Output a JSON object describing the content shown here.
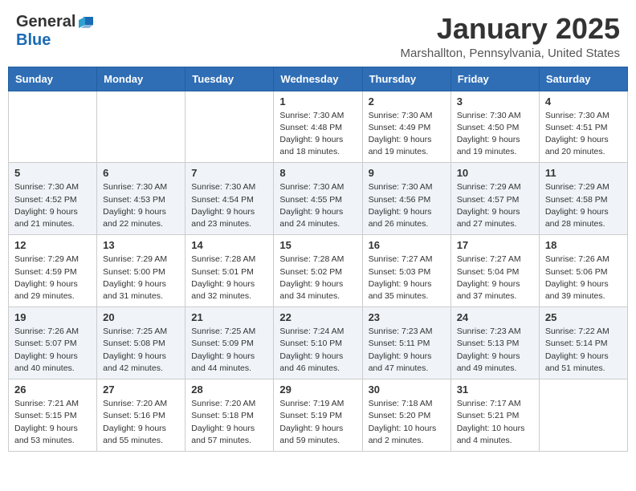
{
  "header": {
    "logo_general": "General",
    "logo_blue": "Blue",
    "month_title": "January 2025",
    "location": "Marshallton, Pennsylvania, United States"
  },
  "days_of_week": [
    "Sunday",
    "Monday",
    "Tuesday",
    "Wednesday",
    "Thursday",
    "Friday",
    "Saturday"
  ],
  "weeks": [
    {
      "days": [
        {
          "number": "",
          "info": ""
        },
        {
          "number": "",
          "info": ""
        },
        {
          "number": "",
          "info": ""
        },
        {
          "number": "1",
          "info": "Sunrise: 7:30 AM\nSunset: 4:48 PM\nDaylight: 9 hours\nand 18 minutes."
        },
        {
          "number": "2",
          "info": "Sunrise: 7:30 AM\nSunset: 4:49 PM\nDaylight: 9 hours\nand 19 minutes."
        },
        {
          "number": "3",
          "info": "Sunrise: 7:30 AM\nSunset: 4:50 PM\nDaylight: 9 hours\nand 19 minutes."
        },
        {
          "number": "4",
          "info": "Sunrise: 7:30 AM\nSunset: 4:51 PM\nDaylight: 9 hours\nand 20 minutes."
        }
      ]
    },
    {
      "days": [
        {
          "number": "5",
          "info": "Sunrise: 7:30 AM\nSunset: 4:52 PM\nDaylight: 9 hours\nand 21 minutes."
        },
        {
          "number": "6",
          "info": "Sunrise: 7:30 AM\nSunset: 4:53 PM\nDaylight: 9 hours\nand 22 minutes."
        },
        {
          "number": "7",
          "info": "Sunrise: 7:30 AM\nSunset: 4:54 PM\nDaylight: 9 hours\nand 23 minutes."
        },
        {
          "number": "8",
          "info": "Sunrise: 7:30 AM\nSunset: 4:55 PM\nDaylight: 9 hours\nand 24 minutes."
        },
        {
          "number": "9",
          "info": "Sunrise: 7:30 AM\nSunset: 4:56 PM\nDaylight: 9 hours\nand 26 minutes."
        },
        {
          "number": "10",
          "info": "Sunrise: 7:29 AM\nSunset: 4:57 PM\nDaylight: 9 hours\nand 27 minutes."
        },
        {
          "number": "11",
          "info": "Sunrise: 7:29 AM\nSunset: 4:58 PM\nDaylight: 9 hours\nand 28 minutes."
        }
      ]
    },
    {
      "days": [
        {
          "number": "12",
          "info": "Sunrise: 7:29 AM\nSunset: 4:59 PM\nDaylight: 9 hours\nand 29 minutes."
        },
        {
          "number": "13",
          "info": "Sunrise: 7:29 AM\nSunset: 5:00 PM\nDaylight: 9 hours\nand 31 minutes."
        },
        {
          "number": "14",
          "info": "Sunrise: 7:28 AM\nSunset: 5:01 PM\nDaylight: 9 hours\nand 32 minutes."
        },
        {
          "number": "15",
          "info": "Sunrise: 7:28 AM\nSunset: 5:02 PM\nDaylight: 9 hours\nand 34 minutes."
        },
        {
          "number": "16",
          "info": "Sunrise: 7:27 AM\nSunset: 5:03 PM\nDaylight: 9 hours\nand 35 minutes."
        },
        {
          "number": "17",
          "info": "Sunrise: 7:27 AM\nSunset: 5:04 PM\nDaylight: 9 hours\nand 37 minutes."
        },
        {
          "number": "18",
          "info": "Sunrise: 7:26 AM\nSunset: 5:06 PM\nDaylight: 9 hours\nand 39 minutes."
        }
      ]
    },
    {
      "days": [
        {
          "number": "19",
          "info": "Sunrise: 7:26 AM\nSunset: 5:07 PM\nDaylight: 9 hours\nand 40 minutes."
        },
        {
          "number": "20",
          "info": "Sunrise: 7:25 AM\nSunset: 5:08 PM\nDaylight: 9 hours\nand 42 minutes."
        },
        {
          "number": "21",
          "info": "Sunrise: 7:25 AM\nSunset: 5:09 PM\nDaylight: 9 hours\nand 44 minutes."
        },
        {
          "number": "22",
          "info": "Sunrise: 7:24 AM\nSunset: 5:10 PM\nDaylight: 9 hours\nand 46 minutes."
        },
        {
          "number": "23",
          "info": "Sunrise: 7:23 AM\nSunset: 5:11 PM\nDaylight: 9 hours\nand 47 minutes."
        },
        {
          "number": "24",
          "info": "Sunrise: 7:23 AM\nSunset: 5:13 PM\nDaylight: 9 hours\nand 49 minutes."
        },
        {
          "number": "25",
          "info": "Sunrise: 7:22 AM\nSunset: 5:14 PM\nDaylight: 9 hours\nand 51 minutes."
        }
      ]
    },
    {
      "days": [
        {
          "number": "26",
          "info": "Sunrise: 7:21 AM\nSunset: 5:15 PM\nDaylight: 9 hours\nand 53 minutes."
        },
        {
          "number": "27",
          "info": "Sunrise: 7:20 AM\nSunset: 5:16 PM\nDaylight: 9 hours\nand 55 minutes."
        },
        {
          "number": "28",
          "info": "Sunrise: 7:20 AM\nSunset: 5:18 PM\nDaylight: 9 hours\nand 57 minutes."
        },
        {
          "number": "29",
          "info": "Sunrise: 7:19 AM\nSunset: 5:19 PM\nDaylight: 9 hours\nand 59 minutes."
        },
        {
          "number": "30",
          "info": "Sunrise: 7:18 AM\nSunset: 5:20 PM\nDaylight: 10 hours\nand 2 minutes."
        },
        {
          "number": "31",
          "info": "Sunrise: 7:17 AM\nSunset: 5:21 PM\nDaylight: 10 hours\nand 4 minutes."
        },
        {
          "number": "",
          "info": ""
        }
      ]
    }
  ]
}
